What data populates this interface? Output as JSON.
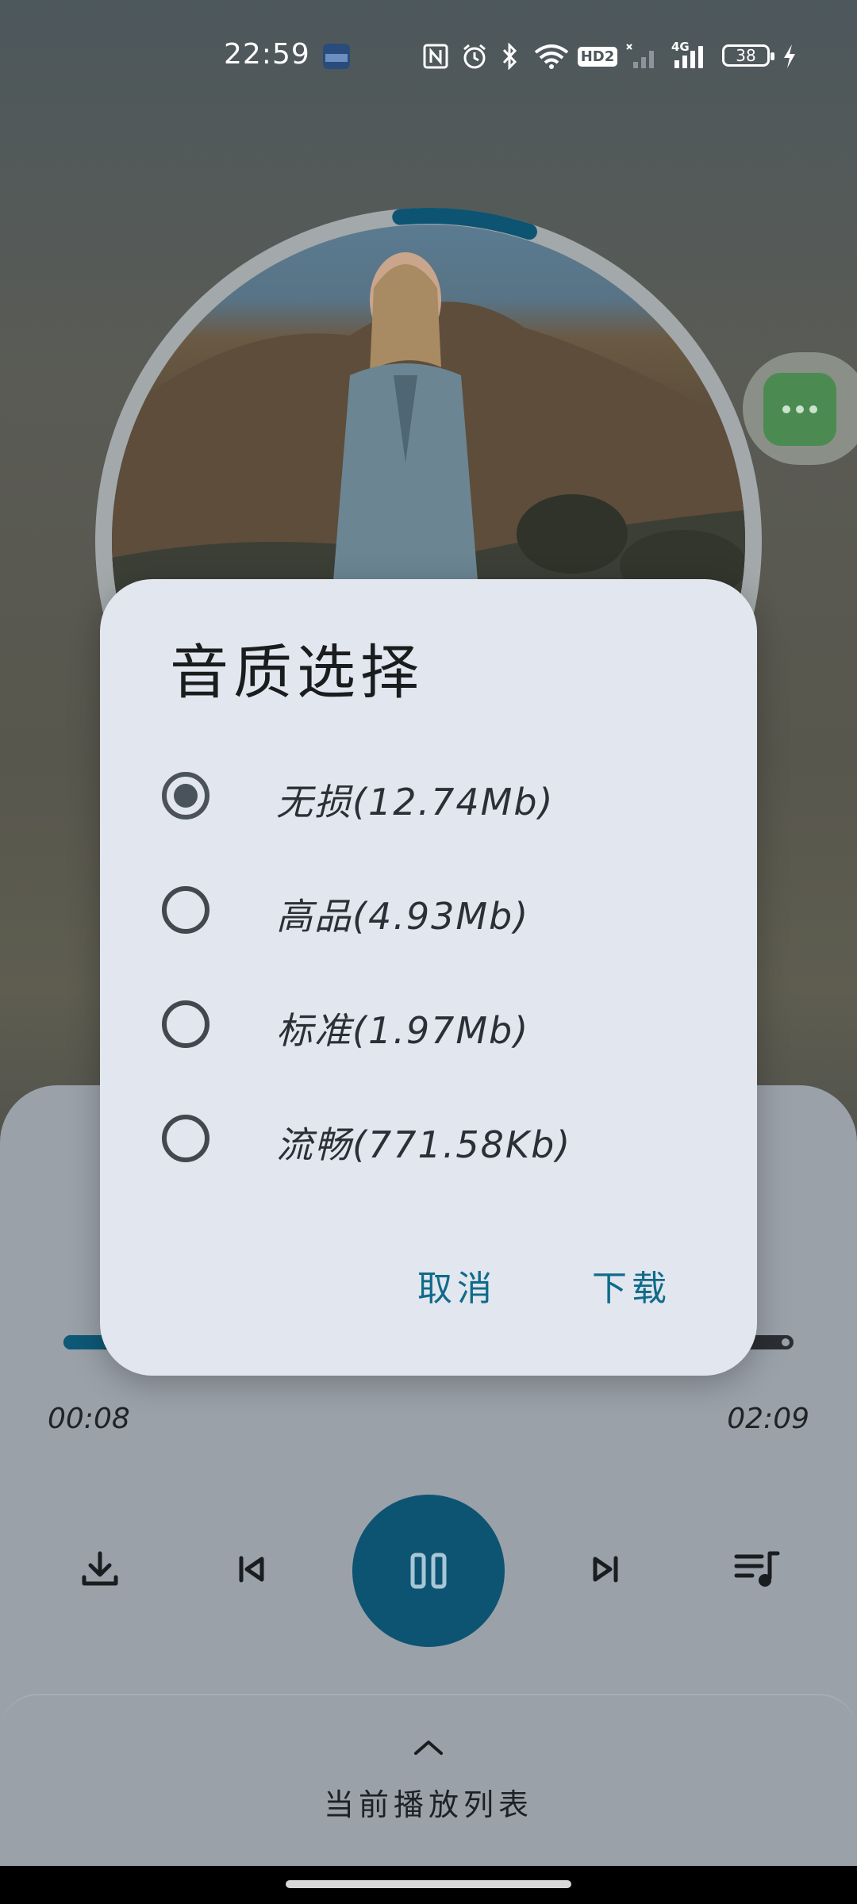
{
  "status_bar": {
    "time": "22:59",
    "icons": [
      "gallery-thumbnail-icon",
      "nfc-icon",
      "alarm-icon",
      "bluetooth-icon",
      "wifi-icon",
      "hd-call-icon",
      "signal-weak-icon",
      "4g-signal-icon",
      "battery-icon",
      "charging-icon"
    ],
    "hd_label": "HD2",
    "network_label": "4G",
    "battery_level": "38"
  },
  "album": {
    "progress_fraction": 0.064
  },
  "dialog": {
    "title": "音质选择",
    "options": [
      {
        "label": "无损(12.74Mb)",
        "selected": true
      },
      {
        "label": "高品(4.93Mb)",
        "selected": false
      },
      {
        "label": "标准(1.97Mb)",
        "selected": false
      },
      {
        "label": "流畅(771.58Kb)",
        "selected": false
      }
    ],
    "cancel_label": "取消",
    "confirm_label": "下载"
  },
  "player": {
    "elapsed": "00:08",
    "total": "02:09",
    "progress_fraction": 0.062
  },
  "playlist": {
    "label": "当前播放列表"
  },
  "colors": {
    "accent": "#0d5473",
    "dialog_bg": "#e2e6ee",
    "more_button": "#4b8b52"
  }
}
